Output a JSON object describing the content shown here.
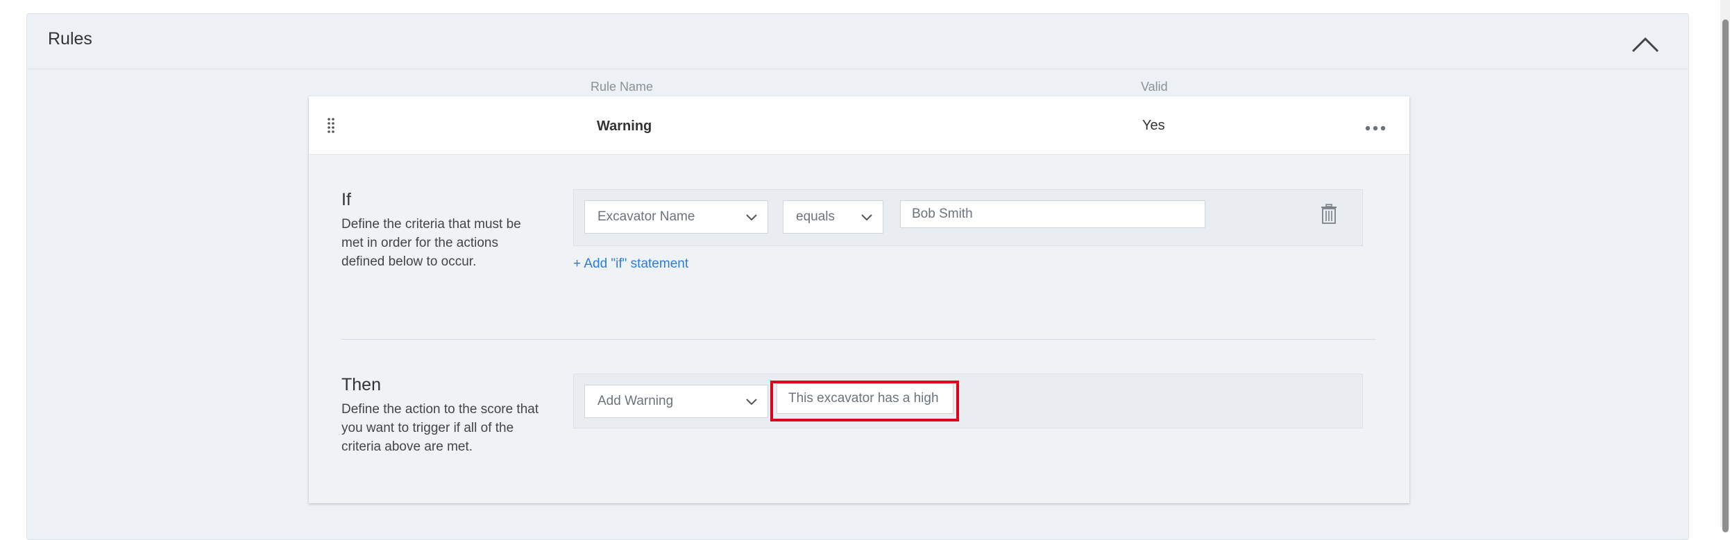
{
  "panel": {
    "title": "Rules"
  },
  "columns": {
    "rule_name": "Rule Name",
    "valid": "Valid"
  },
  "rule": {
    "name": "Warning",
    "valid": "Yes",
    "if_section": {
      "title": "If",
      "description": "Define the criteria that must be met in order for the actions defined below to occur.",
      "field_select": "Excavator Name",
      "operator_select": "equals",
      "value": "Bob Smith",
      "add_statement": "+ Add \"if\" statement"
    },
    "then_section": {
      "title": "Then",
      "description": "Define the action to the score that you want to trigger if all of the criteria above are met.",
      "action_select": "Add Warning",
      "message_value": "This excavator has a high risk"
    }
  },
  "icons": {
    "collapse": "chevron-up-icon",
    "drag": "drag-handle-icon",
    "more": "more-horizontal-icon",
    "delete": "trash-icon",
    "dropdown": "chevron-down-icon"
  },
  "colors": {
    "link": "#2f7bd8",
    "highlight": "#e0001a",
    "panel_bg": "#edf1f5"
  }
}
